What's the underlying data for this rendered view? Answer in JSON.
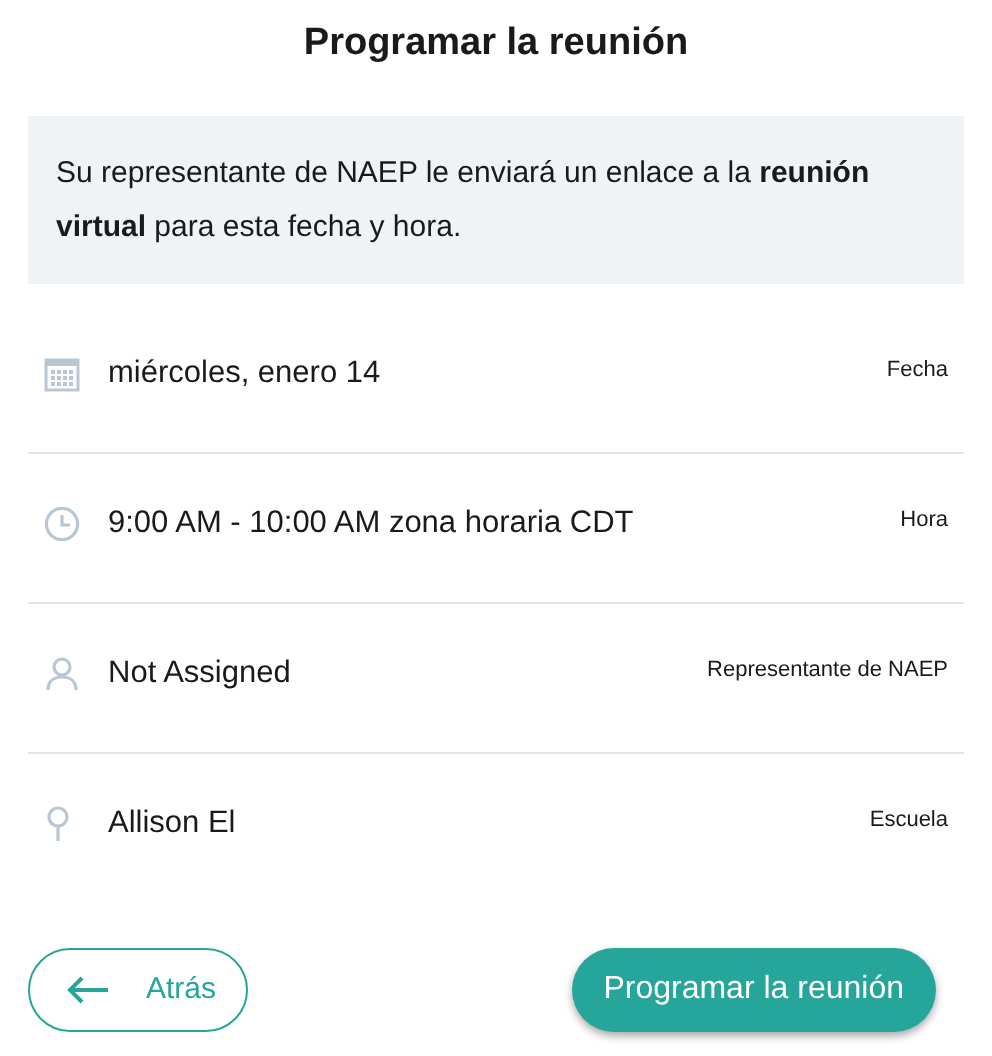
{
  "title": "Programar la reunión",
  "notice": "Su representante de NAEP le enviará un enlace a la **reunión virtual** para esta fecha y hora.",
  "details": [
    {
      "kind": "date",
      "value": "miércoles, enero 14",
      "label": "Fecha"
    },
    {
      "kind": "time",
      "value": "9:00 AM - 10:00 AM zona horaria CDT",
      "label": "Hora"
    },
    {
      "kind": "person",
      "value": "Not Assigned",
      "label": "Representante de NAEP"
    },
    {
      "kind": "location",
      "value": "Allison El",
      "label": "Escuela"
    }
  ],
  "buttons": {
    "back": "Atrás",
    "submit": "Programar la reunión"
  }
}
